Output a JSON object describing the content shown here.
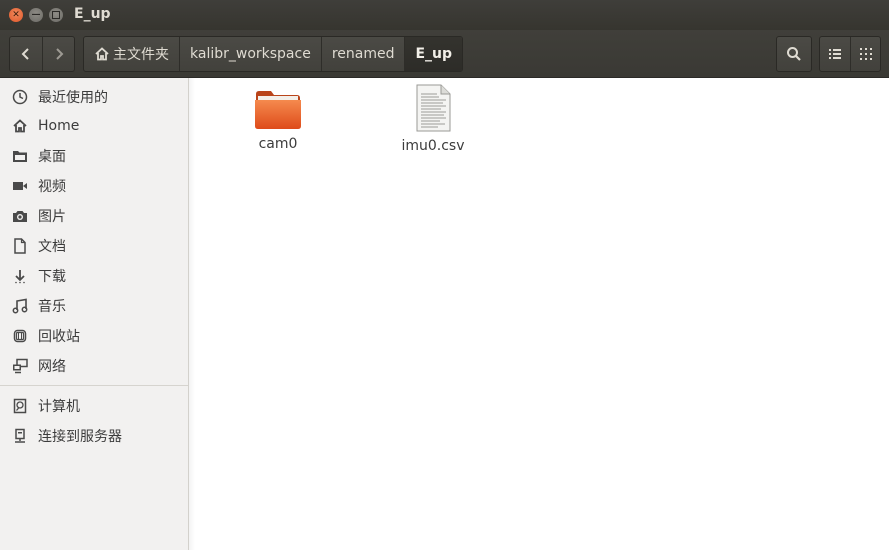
{
  "window": {
    "title": "E_up"
  },
  "toolbar": {
    "breadcrumbs": [
      "主文件夹",
      "kalibr_workspace",
      "renamed",
      "E_up"
    ]
  },
  "sidebar": {
    "items": [
      {
        "label": "最近使用的",
        "icon": "clock-icon"
      },
      {
        "label": "Home",
        "icon": "home-icon"
      },
      {
        "label": "桌面",
        "icon": "folder-desktop-icon"
      },
      {
        "label": "视频",
        "icon": "video-icon"
      },
      {
        "label": "图片",
        "icon": "camera-icon"
      },
      {
        "label": "文档",
        "icon": "document-icon"
      },
      {
        "label": "下载",
        "icon": "download-icon"
      },
      {
        "label": "音乐",
        "icon": "music-icon"
      },
      {
        "label": "回收站",
        "icon": "trash-icon"
      },
      {
        "label": "网络",
        "icon": "network-icon"
      },
      {
        "label": "计算机",
        "icon": "computer-icon"
      },
      {
        "label": "连接到服务器",
        "icon": "server-icon"
      }
    ]
  },
  "files": [
    {
      "name": "cam0",
      "type": "folder"
    },
    {
      "name": "imu0.csv",
      "type": "text-file"
    }
  ],
  "colors": {
    "folder_orange": "#e9632c",
    "titlebar": "#3c3b37",
    "sidebar_bg": "#f2f1f0"
  }
}
